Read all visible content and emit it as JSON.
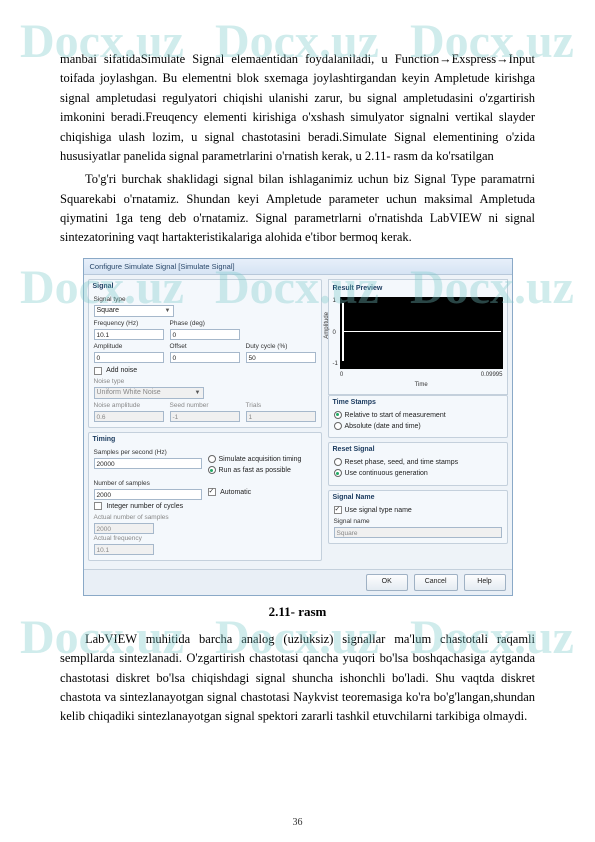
{
  "watermarks": [
    "Docx.uz",
    "Docx.uz",
    "Docx.uz",
    "Docx.uz",
    "Docx.uz",
    "Docx.uz",
    "Docx.uz",
    "Docx.uz",
    "Docx.uz"
  ],
  "p1": "manbai sifatidaSimulate Signal elemaentidan foydalaniladi, u Function→Exspress→Input toifada joylashgan. Bu elementni blok sxemaga joylashtirgandan keyin Ampletude kirishga signal ampletudasi regulyatori chiqishi ulanishi zarur, bu signal ampletudasini o'zgartirish imkonini beradi.Freuqency elementi kirishiga o'xshash simulyator signalni vertikal slayder chiqishiga ulash lozim, u signal chastotasini beradi.Simulate Signal elementining o'zida hususiyatlar panelida signal parametrlarini o'rnatish kerak, u 2.11- rasm da ko'rsatilgan",
  "p2": "To'g'ri burchak shaklidagi signal bilan ishlaganimiz uchun biz Signal Type paramatrni Squarekabi o'rnatamiz. Shundan keyi Ampletude parameter uchun maksimal Ampletuda qiymatini 1ga teng deb o'rnatamiz. Signal parametrlarni o'rnatishda LabVIEW ni signal sintezatorining vaqt hartakteristikalariga alohida e'tibor bermoq kerak.",
  "dialog": {
    "title": "Configure Simulate Signal [Simulate Signal]",
    "signal": {
      "group": "Signal",
      "typeLabel": "Signal type",
      "typeValue": "Square",
      "freqLabel": "Frequency (Hz)",
      "freqValue": "10.1",
      "phaseLabel": "Phase (deg)",
      "phaseValue": "0",
      "ampLabel": "Amplitude",
      "ampValue": "0",
      "offsetLabel": "Offset",
      "offsetValue": "0",
      "dutyLabel": "Duty cycle (%)",
      "dutyValue": "50",
      "addNoise": "Add noise",
      "noiseTypeLabel": "Noise type",
      "noiseTypeValue": "Uniform White Noise",
      "noiseAmpLabel": "Noise amplitude",
      "noiseAmpValue": "0.6",
      "seedLabel": "Seed number",
      "seedValue": "-1",
      "trialsLabel": "Trials",
      "trialsValue": "1"
    },
    "timing": {
      "group": "Timing",
      "spsLabel": "Samples per second (Hz)",
      "spsValue": "20000",
      "simTiming": "Simulate acquisition timing",
      "runFast": "Run as fast as possible",
      "numSamplesLabel": "Number of samples",
      "numSamplesValue": "2000",
      "automatic": "Automatic",
      "intCycles": "Integer number of cycles",
      "actualSamplesLabel": "Actual number of samples",
      "actualSamplesValue": "2000",
      "actualFreqLabel": "Actual frequency",
      "actualFreqValue": "10.1"
    },
    "preview": {
      "group": "Result Preview",
      "y1": "1",
      "y0": "0",
      "ym1": "-1",
      "ylab": "Amplitude",
      "x0": "0",
      "x1": "0.09995",
      "xlab": "Time"
    },
    "timestamps": {
      "group": "Time Stamps",
      "relative": "Relative to start of measurement",
      "absolute": "Absolute (date and time)"
    },
    "reset": {
      "group": "Reset Signal",
      "resetPhase": "Reset phase, seed, and time stamps",
      "continuous": "Use continuous generation"
    },
    "signalName": {
      "group": "Signal Name",
      "useType": "Use signal type name",
      "nameLabel": "Signal name",
      "nameValue": "Square"
    },
    "buttons": {
      "ok": "OK",
      "cancel": "Cancel",
      "help": "Help"
    }
  },
  "figcap": "2.11- rasm",
  "p3": "LabVIEW muhitida barcha analog (uzluksiz) signallar ma'lum chastotali raqamli sempllarda sintezlanadi. O'zgartirish chastotasi qancha yuqori bo'lsa boshqachasiga aytganda chastotasi diskret bo'lsa chiqishdagi signal shuncha ishonchli bo'ladi. Shu vaqtda diskret chastota va sintezlanayotgan signal chastotasi Naykvist teoremasiga ko'ra bo'g'langan,shundan kelib chiqadiki sintezlanayotgan signal spektori zararli tashkil etuvchilarni tarkibiga olmaydi.",
  "pagenum": "36"
}
